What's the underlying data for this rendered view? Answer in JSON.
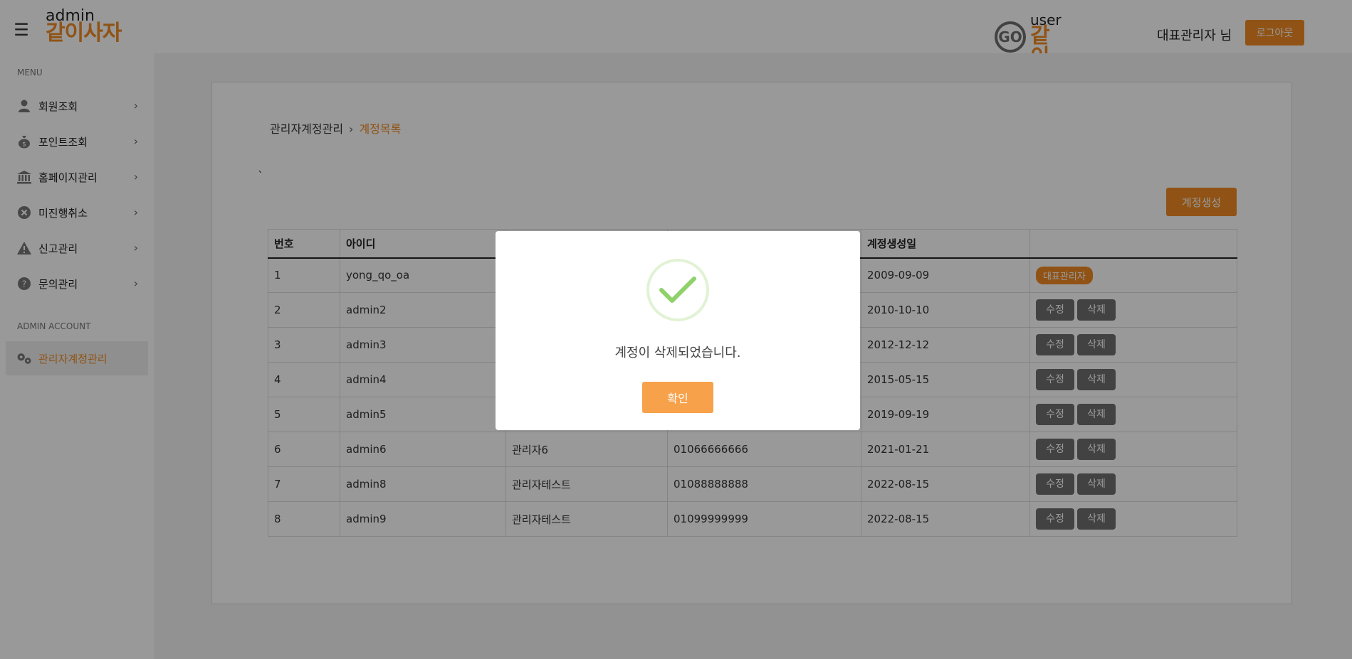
{
  "header": {
    "admin_logo_small": "admin",
    "admin_logo_big": "같이사자",
    "user_logo_go": "GO",
    "user_logo_small": "user",
    "user_logo_big": "같이사자",
    "user_name": "대표관리자 님",
    "logout_label": "로그아웃"
  },
  "sidebar": {
    "menu_section": "MENU",
    "items": [
      {
        "label": "회원조회",
        "icon": "person-icon"
      },
      {
        "label": "포인트조회",
        "icon": "money-bag-icon"
      },
      {
        "label": "홈페이지관리",
        "icon": "bank-icon"
      },
      {
        "label": "미진행취소",
        "icon": "cancel-circle-icon"
      },
      {
        "label": "신고관리",
        "icon": "warning-icon"
      },
      {
        "label": "문의관리",
        "icon": "question-icon"
      }
    ],
    "admin_section": "ADMIN ACCOUNT",
    "admin_item": {
      "label": "관리자계정관리",
      "icon": "gears-icon"
    }
  },
  "main": {
    "breadcrumb_parent": "관리자계정관리",
    "breadcrumb_sep": "›",
    "breadcrumb_current": "계정목록",
    "stray_text": "`",
    "create_button": "계정생성",
    "table": {
      "headers": [
        "번호",
        "아이디",
        "",
        "",
        "계정생성일",
        ""
      ],
      "rows": [
        {
          "no": "1",
          "id": "yong_qo_oa",
          "name": "",
          "phone": "",
          "date": "2009-09-09"
        },
        {
          "no": "2",
          "id": "admin2",
          "name": "",
          "phone": "",
          "date": "2010-10-10"
        },
        {
          "no": "3",
          "id": "admin3",
          "name": "",
          "phone": "",
          "date": "2012-12-12"
        },
        {
          "no": "4",
          "id": "admin4",
          "name": "",
          "phone": "",
          "date": "2015-05-15"
        },
        {
          "no": "5",
          "id": "admin5",
          "name": "",
          "phone": "",
          "date": "2019-09-19"
        },
        {
          "no": "6",
          "id": "admin6",
          "name": "관리자6",
          "phone": "01066666666",
          "date": "2021-01-21"
        },
        {
          "no": "7",
          "id": "admin8",
          "name": "관리자테스트",
          "phone": "01088888888",
          "date": "2022-08-15"
        },
        {
          "no": "8",
          "id": "admin9",
          "name": "관리자테스트",
          "phone": "01099999999",
          "date": "2022-08-15"
        }
      ],
      "badge_label": "대표관리자",
      "edit_label": "수정",
      "delete_label": "삭제"
    }
  },
  "modal": {
    "message": "계정이 삭제되었습니다.",
    "ok_label": "확인",
    "check_color": "#8fd16a"
  },
  "colors": {
    "accent": "#f08a24",
    "button_gray": "#6f6f6f"
  }
}
